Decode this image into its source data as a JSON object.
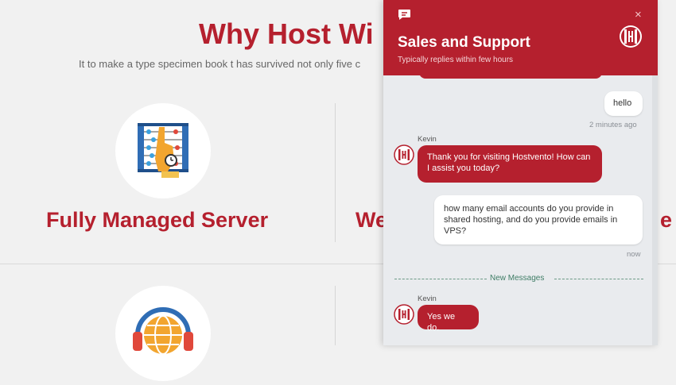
{
  "page": {
    "heading": "Why Host Wi",
    "subheading": "It to make a type specimen book t has survived not only five c",
    "features": [
      {
        "title": "Fully Managed Server",
        "icon": "abacus-icon"
      },
      {
        "title": "We",
        "icon": "headset-globe-icon"
      }
    ],
    "feature_tail": "e",
    "colors": {
      "brand": "#b5202e",
      "background": "#f1f1f1"
    }
  },
  "chat": {
    "title": "Sales and Support",
    "subtitle": "Typically replies within few hours",
    "close_icon": "×",
    "messages": [
      {
        "from": "user",
        "text": "hello",
        "time": "2 minutes ago"
      },
      {
        "from": "agent",
        "sender": "Kevin",
        "text": "Thank you for visiting Hostvento! How can I assist you today?"
      },
      {
        "from": "user",
        "text": "how many email accounts do you provide in shared hosting, and do you provide emails in VPS?",
        "time": "now"
      },
      {
        "from": "agent",
        "sender": "Kevin",
        "text": "Yes we do."
      }
    ],
    "divider": "New Messages"
  }
}
